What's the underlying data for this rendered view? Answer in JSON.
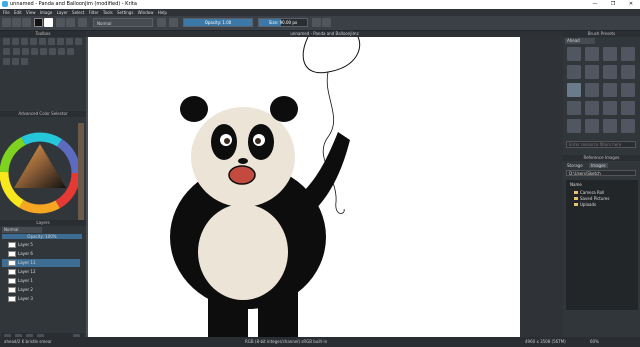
{
  "window": {
    "title": "unnamed - Panda and BalloonJim (modified) - Krita",
    "minimize": "—",
    "maximize": "❐",
    "close": "✕"
  },
  "menu": [
    "File",
    "Edit",
    "View",
    "Image",
    "Layer",
    "Select",
    "Filter",
    "Tools",
    "Settings",
    "Window",
    "Help"
  ],
  "toolbar": {
    "blend_mode": "Normal",
    "opacity_label": "Opacity: 1.00",
    "opacity_fraction": 1.0,
    "size_label": "Size: 90.00 px",
    "size_fraction": 0.45
  },
  "dockers": {
    "tools_title": "Toolbox",
    "color_title": "Advanced Color Selector",
    "layers_title": "Layers",
    "layers_blend": "Normal",
    "layers_opacity": "Opacity: 100%",
    "brush_presets_title": "Brush Presets",
    "brush_tag": "Ahead",
    "brush_search_placeholder": "Enter resource filters here",
    "reference_title": "Reference Images",
    "reference_tabs": [
      "Storage",
      "Images"
    ],
    "reference_path": "D:\\Users\\Sketch",
    "folders_header": "Name",
    "folders": [
      "Camera Roll",
      "Saved Pictures",
      "Uploads"
    ]
  },
  "layers": [
    {
      "name": "Layer 5"
    },
    {
      "name": "Layer 6"
    },
    {
      "name": "Layer 11"
    },
    {
      "name": "Layer 12"
    },
    {
      "name": "Layer 1"
    },
    {
      "name": "Layer 2"
    },
    {
      "name": "Layer 3"
    }
  ],
  "document": {
    "tab_title": "unnamed - Panda and BalloonJimz"
  },
  "status": {
    "left": "ahead/2 K bristle smear",
    "color": "RGB (8-bit integer/channel)  sRGB built-in",
    "size": "4960 x 3508 (56TM)",
    "zoom": "60%"
  },
  "colors": {
    "panda_black": "#0d0d0d",
    "panda_body": "#ece4d6",
    "mouth": "#c24a3f",
    "accent": "#3daee9"
  }
}
